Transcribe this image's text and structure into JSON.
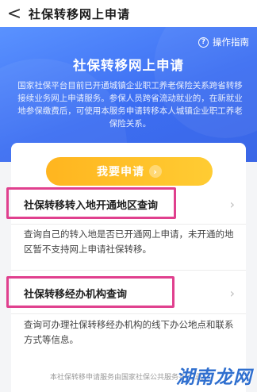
{
  "nav": {
    "back_glyph": "<",
    "title": "社保转移网上申请"
  },
  "banner": {
    "guide_icon": "question-circle-icon",
    "guide_label": "操作指南",
    "heading": "社保转移网上申请",
    "description": "国家社保平台目前已开通城镇企业职工养老保险关系跨省转移接续业务网上申请服务。参保人员跨省流动就业的，在新就业地参保缴费后，可使用本服务申请转移本人城镇企业职工养老保险关系。"
  },
  "apply_button": {
    "label": "我要申请",
    "icon": "arrow-right-circle-icon"
  },
  "cards": [
    {
      "title": "社保转移转入地开通地区查询",
      "description": "查询自己的转入地是否已开通网上申请，未开通的地区暂不支持网上申请社保转移。"
    },
    {
      "title": "社保转移经办机构查询",
      "description": "查询可办理社保转移经办机构的线下办公地点和联系方式等信息。"
    }
  ],
  "footer_text": "本社保转移申请服务由国家社保公共服务平台提供",
  "watermark": "湖南龙网",
  "colors": {
    "banner": "#3c6ef2",
    "button": "#ffb51f",
    "highlight": "#e0408e"
  }
}
